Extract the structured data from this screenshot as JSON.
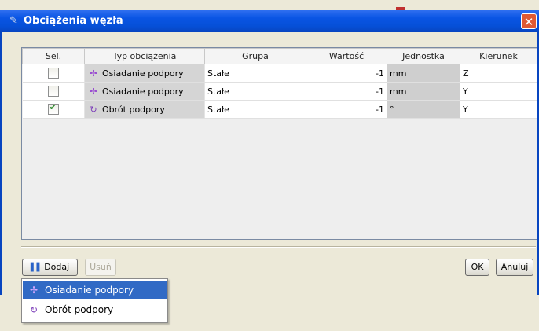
{
  "window": {
    "title": "Obciążenia węzła",
    "close_label": "✕",
    "title_icon": "node-load-icon"
  },
  "table": {
    "columns": [
      "Sel.",
      "Typ obciążenia",
      "Grupa",
      "Wartość",
      "Jednostka",
      "Kierunek"
    ],
    "rows": [
      {
        "selected": false,
        "type": "Osiadanie podpory",
        "type_icon": "support-settlement-icon",
        "group": "Stałe",
        "value": "-1",
        "unit": "mm",
        "direction": "Z"
      },
      {
        "selected": false,
        "type": "Osiadanie podpory",
        "type_icon": "support-settlement-icon",
        "group": "Stałe",
        "value": "-1",
        "unit": "mm",
        "direction": "Y"
      },
      {
        "selected": true,
        "type": "Obrót podpory",
        "type_icon": "support-rotation-icon",
        "group": "Stałe",
        "value": "-1",
        "unit": "°",
        "direction": "Y"
      }
    ]
  },
  "buttons": {
    "add": "Dodaj",
    "remove": "Usuń",
    "ok": "OK",
    "cancel": "Anuluj"
  },
  "popup_menu": {
    "items": [
      {
        "label": "Osiadanie podpory",
        "icon": "support-settlement-icon",
        "highlighted": true
      },
      {
        "label": "Obrót podpory",
        "icon": "support-rotation-icon",
        "highlighted": false
      }
    ]
  },
  "colors": {
    "titlebar": "#0a55e4",
    "selection": "#316ac5",
    "close": "#e05a34"
  }
}
